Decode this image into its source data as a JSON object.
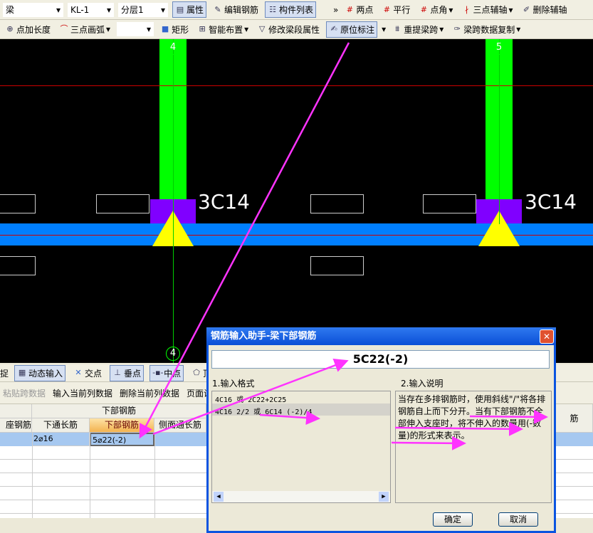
{
  "toolbar1": {
    "type": "梁",
    "name": "KL-1",
    "layer": "分层1",
    "attr": "属性",
    "edit_rebar": "编辑钢筋",
    "comp_list": "构件列表",
    "two_point": "两点",
    "parallel": "平行",
    "point_angle": "点角",
    "three_point_axis": "三点辅轴",
    "delete_axis": "删除辅轴"
  },
  "toolbar2": {
    "point_length": "点加长度",
    "three_arc": "三点画弧",
    "rect": "矩形",
    "smart": "智能布置",
    "modify_seg": "修改梁段属性",
    "in_situ": "原位标注",
    "re_span": "重提梁跨",
    "copy_span": "梁跨数据复制"
  },
  "canvas": {
    "label_left": "3C14",
    "label_right": "3C14",
    "axis_top_left": "4",
    "axis_top_right": "5",
    "axis_bottom": "4"
  },
  "snapbar": {
    "dyn_input": "动态输入",
    "intersect": "交点",
    "perp": "垂点",
    "mid": "中点",
    "vertex": "顶点",
    "cut": "捉"
  },
  "gridbar": {
    "paste": "粘贴跨数据",
    "input_col": "输入当前列数据",
    "del_col": "删除当前列数据",
    "page": "页面设"
  },
  "table": {
    "group": "下部钢筋",
    "headers": [
      "座钢筋",
      "下通长筋",
      "下部钢筋",
      "侧面通长筋"
    ],
    "right_header": "筋",
    "row": [
      "",
      "2⌀16",
      "5⌀22(-2)",
      ""
    ]
  },
  "dialog": {
    "title": "钢筋输入助手-梁下部钢筋",
    "value": "5C22(-2)",
    "format_label": "1.输入格式",
    "format_items": [
      "4C16 或 2C22+2C25",
      "4C16 2/2 或 6C14 (-2)/4"
    ],
    "desc_label": "2.输入说明",
    "desc": "当存在多排钢筋时，使用斜线\"/\"将各排钢筋自上而下分开。当有下部钢筋不全部伸入支座时，将不伸入的数量用(-数量)的形式来表示。",
    "ok": "确定",
    "cancel": "取消"
  },
  "colors": {
    "column": "#00ff00",
    "support": "#8000ff",
    "beam": "#007fff",
    "triangle": "#ffff00",
    "arrow": "#ff33ff",
    "title_bar": "#0a54e0"
  }
}
